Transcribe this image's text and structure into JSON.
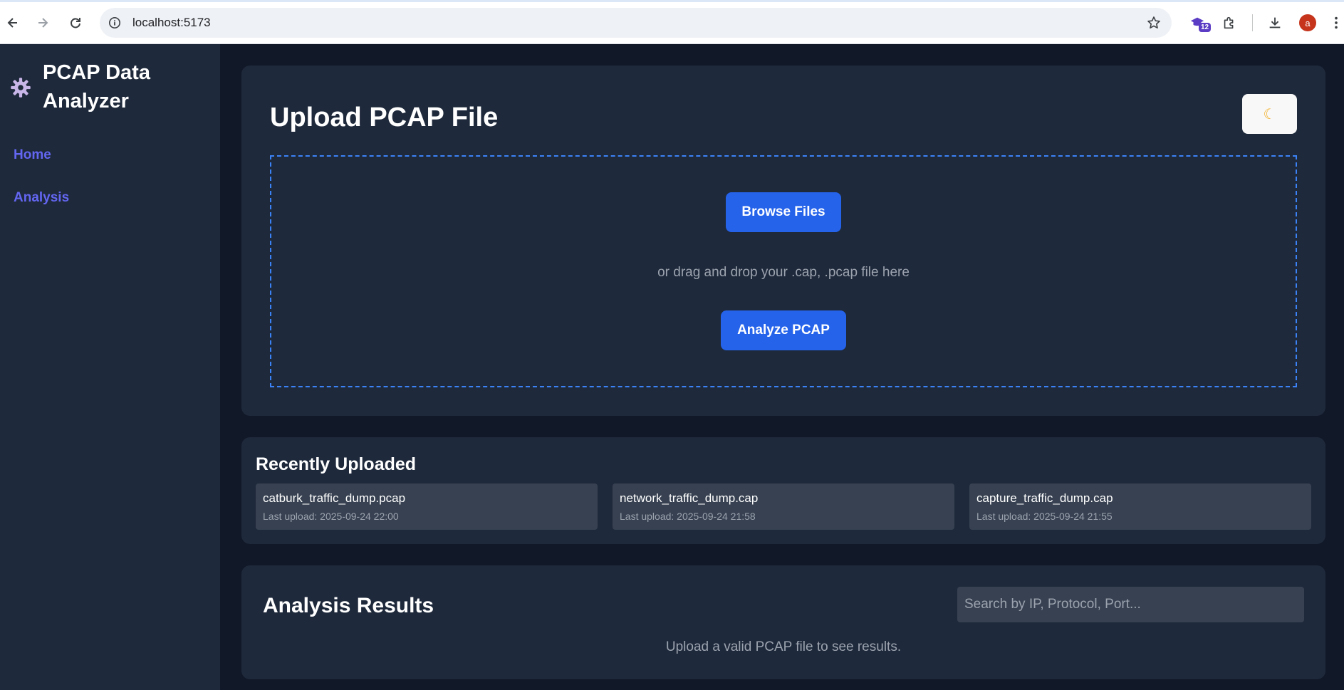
{
  "browser": {
    "url": "localhost:5173",
    "extension_badge": "12",
    "profile_initial": "a"
  },
  "sidebar": {
    "brand_icon": "gear-icon",
    "title_line1": "PCAP Data",
    "title_line2": "Analyzer",
    "items": [
      {
        "label": "Home"
      },
      {
        "label": "Analysis"
      }
    ]
  },
  "upload": {
    "title": "Upload PCAP File",
    "theme_toggle_icon": "moon-icon",
    "browse_label": "Browse Files",
    "drop_hint": "or drag and drop your .cap, .pcap file here",
    "analyze_label": "Analyze PCAP"
  },
  "recent": {
    "title": "Recently Uploaded",
    "items": [
      {
        "name": "catburk_traffic_dump.pcap",
        "date": "Last upload: 2025-09-24 22:00"
      },
      {
        "name": "network_traffic_dump.cap",
        "date": "Last upload: 2025-09-24 21:58"
      },
      {
        "name": "capture_traffic_dump.cap",
        "date": "Last upload: 2025-09-24 21:55"
      }
    ]
  },
  "results": {
    "title": "Analysis Results",
    "search_placeholder": "Search by IP, Protocol, Port...",
    "empty_message": "Upload a valid PCAP file to see results."
  },
  "colors": {
    "accent": "#2563eb",
    "nav_link": "#6366f1",
    "card_bg": "#1e293b",
    "page_bg": "#111827"
  }
}
